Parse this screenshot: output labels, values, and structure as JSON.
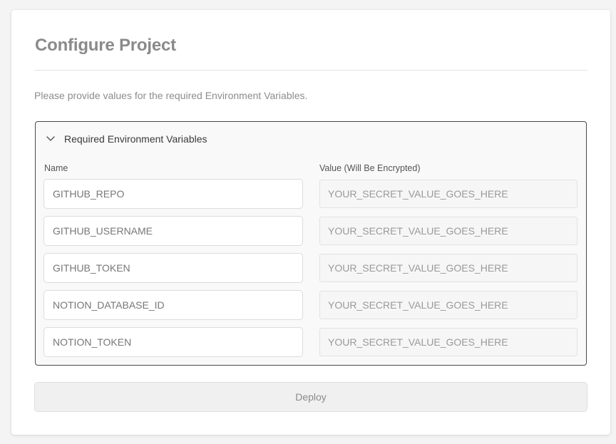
{
  "page": {
    "title": "Configure Project",
    "description": "Please provide values for the required Environment Variables."
  },
  "env_panel": {
    "title": "Required Environment Variables",
    "expanded": true,
    "toggle_icon": "chevron-down-icon",
    "name_column_label": "Name",
    "value_column_label": "Value (Will Be Encrypted)",
    "variables": [
      {
        "name": "GITHUB_REPO",
        "value": "",
        "value_placeholder": "YOUR_SECRET_VALUE_GOES_HERE"
      },
      {
        "name": "GITHUB_USERNAME",
        "value": "",
        "value_placeholder": "YOUR_SECRET_VALUE_GOES_HERE"
      },
      {
        "name": "GITHUB_TOKEN",
        "value": "",
        "value_placeholder": "YOUR_SECRET_VALUE_GOES_HERE"
      },
      {
        "name": "NOTION_DATABASE_ID",
        "value": "",
        "value_placeholder": "YOUR_SECRET_VALUE_GOES_HERE"
      },
      {
        "name": "NOTION_TOKEN",
        "value": "",
        "value_placeholder": "YOUR_SECRET_VALUE_GOES_HERE"
      }
    ]
  },
  "actions": {
    "deploy_label": "Deploy"
  },
  "colors": {
    "title_text": "#8a8a8a",
    "panel_border": "#4a4a4a",
    "panel_background": "#f9f9f9",
    "button_background": "#f0f0f0"
  }
}
